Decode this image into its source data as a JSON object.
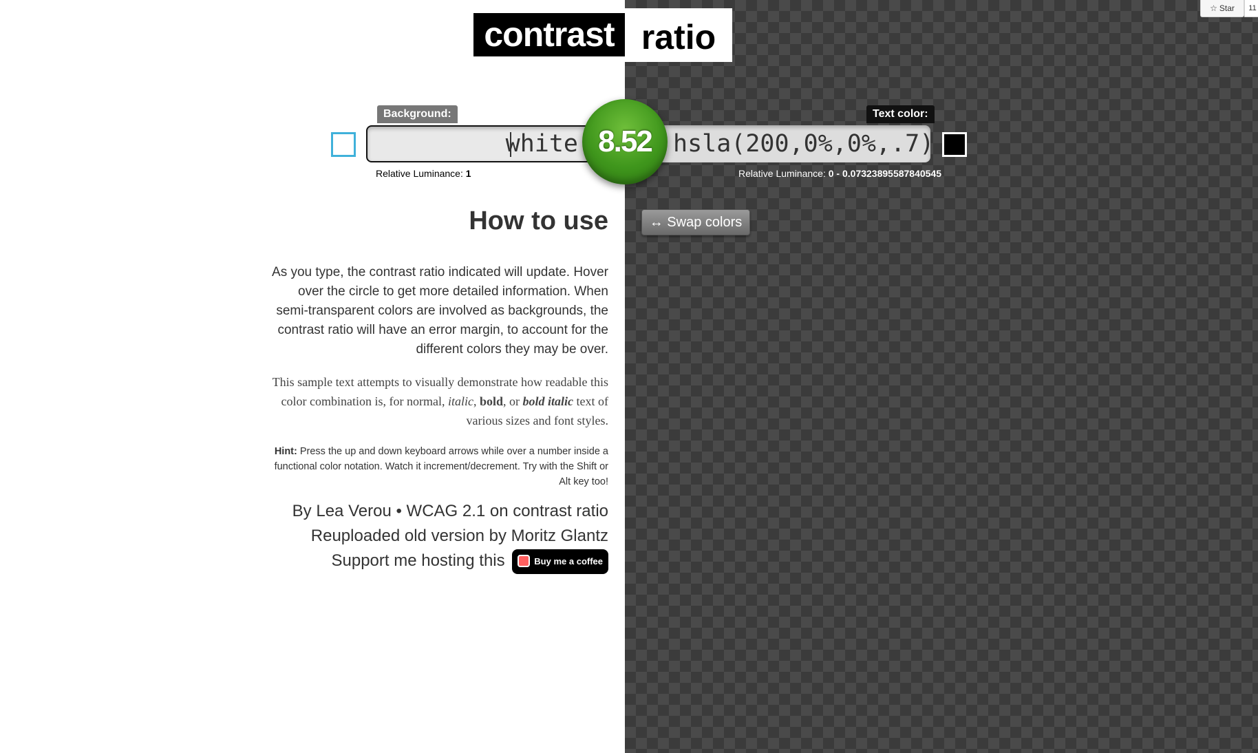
{
  "logo": {
    "part1": "contrast",
    "part2": "ratio"
  },
  "github": {
    "star_label": "Star",
    "star_count": "11"
  },
  "background": {
    "label": "Background:",
    "value": "white",
    "luminance_label": "Relative Luminance:",
    "luminance_value": "1",
    "swatch_color": "#ffffff"
  },
  "text_color": {
    "label": "Text color:",
    "value": "hsla(200,0%,0%,.7)",
    "luminance_label": "Relative Luminance:",
    "luminance_value": "0 - 0.07323895587840545",
    "swatch_color": "#000000"
  },
  "ratio": {
    "value": "8.52",
    "color": "#3f961c"
  },
  "swap_button": {
    "label": "↔ Swap colors"
  },
  "howto": {
    "title": "How to use",
    "usage": "As you type, the contrast ratio indicated will update. Hover over the circle to get more detailed information. When semi-transparent colors are involved as backgrounds, the contrast ratio will have an error margin, to account for the different colors they may be over.",
    "sample": {
      "pre": "This sample text attempts to visually demonstrate how readable this color combination is, for normal, ",
      "italic": "italic",
      "sep1": ", ",
      "bold": "bold",
      "sep2": ", or ",
      "bold_italic": "bold italic",
      "post": " text of various sizes and font styles."
    },
    "hint_label": "Hint:",
    "hint_text": " Press the up and down keyboard arrows while over a number inside a functional color notation. Watch it increment/decrement. Try with the Shift or Alt key too!"
  },
  "credits": {
    "by": "By ",
    "author": "Lea Verou",
    "bullet": " • ",
    "wcag": "WCAG 2.1 on contrast ratio",
    "reupload": "Reuploaded old version by Moritz Glantz",
    "support": "Support me hosting this",
    "coffee_button": "Buy me a coffee"
  }
}
